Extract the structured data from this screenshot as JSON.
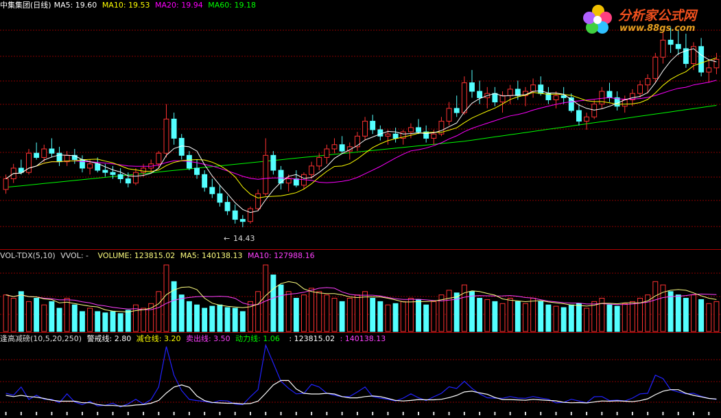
{
  "main_header": {
    "title": "中集集团(日线)",
    "ma5": "MA5: 19.60",
    "ma10": "MA10: 19.53",
    "ma20": "MA20: 19.94",
    "ma60": "MA60: 19.18"
  },
  "vol_header": {
    "name": "VOL-TDX(5,10)",
    "vvol": "VVOL: -",
    "volume": "VOLUME: 123815.02",
    "ma5": "MA5: 140138.13",
    "ma10": "MA10: 127988.16"
  },
  "ind_header": {
    "name": "逢高减磅(10,5,20,250)",
    "warn": "警戒线: 2.80",
    "reduce": "减仓线: 3.20",
    "sell": "卖出线: 3.50",
    "power": "动力线: 1.06",
    "v1": ": 123815.02",
    "v2": ": 140138.13"
  },
  "low_marker": "14.43",
  "logo": {
    "cn": "分析家公式网",
    "url": "www.88gs.com"
  },
  "colors": {
    "up": "#ff3232",
    "down": "#54ffff",
    "ma5": "#ffffff",
    "ma10": "#ffff00",
    "ma20": "#ff00ff",
    "ma60": "#00ff00",
    "grid": "#8b0000",
    "ind_blue": "#2222ff",
    "ind_white": "#ffffff"
  },
  "chart_data": {
    "type": "candlestick",
    "price_ylim": [
      13.5,
      24.5
    ],
    "candles": [
      [
        16.2,
        16.9,
        16.0,
        16.7
      ],
      [
        16.7,
        17.4,
        16.5,
        17.2
      ],
      [
        17.2,
        17.6,
        16.9,
        17.0
      ],
      [
        17.0,
        18.1,
        16.9,
        17.9
      ],
      [
        17.9,
        18.4,
        17.6,
        17.7
      ],
      [
        17.7,
        18.3,
        17.5,
        18.1
      ],
      [
        18.1,
        18.6,
        17.7,
        17.9
      ],
      [
        17.9,
        18.2,
        17.3,
        17.5
      ],
      [
        17.5,
        18.0,
        17.3,
        17.8
      ],
      [
        17.8,
        18.1,
        17.4,
        17.6
      ],
      [
        17.6,
        17.8,
        17.0,
        17.2
      ],
      [
        17.2,
        17.6,
        16.9,
        17.4
      ],
      [
        17.4,
        17.7,
        17.0,
        17.1
      ],
      [
        17.1,
        17.4,
        16.8,
        17.0
      ],
      [
        17.0,
        17.3,
        16.7,
        16.9
      ],
      [
        16.9,
        17.2,
        16.5,
        16.7
      ],
      [
        16.7,
        17.0,
        16.3,
        16.5
      ],
      [
        16.5,
        17.2,
        16.4,
        17.0
      ],
      [
        17.0,
        17.4,
        16.8,
        17.2
      ],
      [
        17.2,
        17.6,
        17.0,
        17.4
      ],
      [
        17.4,
        18.0,
        17.2,
        17.9
      ],
      [
        17.9,
        20.2,
        17.7,
        19.5
      ],
      [
        19.5,
        19.8,
        18.3,
        18.6
      ],
      [
        18.6,
        18.8,
        17.6,
        17.8
      ],
      [
        17.8,
        18.0,
        17.1,
        17.2
      ],
      [
        17.2,
        17.6,
        16.7,
        16.9
      ],
      [
        16.9,
        17.1,
        16.1,
        16.3
      ],
      [
        16.3,
        16.7,
        15.8,
        16.0
      ],
      [
        16.0,
        16.4,
        15.4,
        15.6
      ],
      [
        15.6,
        15.9,
        15.0,
        15.2
      ],
      [
        15.2,
        15.5,
        14.6,
        14.8
      ],
      [
        14.8,
        15.0,
        14.43,
        14.7
      ],
      [
        14.7,
        15.4,
        14.6,
        15.3
      ],
      [
        15.3,
        16.2,
        15.2,
        16.0
      ],
      [
        16.0,
        18.6,
        15.9,
        17.8
      ],
      [
        17.8,
        18.0,
        16.9,
        17.1
      ],
      [
        17.1,
        17.3,
        16.2,
        16.5
      ],
      [
        16.5,
        16.9,
        16.1,
        16.7
      ],
      [
        16.7,
        17.1,
        16.3,
        16.4
      ],
      [
        16.4,
        17.0,
        16.2,
        16.9
      ],
      [
        16.9,
        17.5,
        16.7,
        17.3
      ],
      [
        17.3,
        17.9,
        17.1,
        17.7
      ],
      [
        17.7,
        18.3,
        17.4,
        18.1
      ],
      [
        18.1,
        18.6,
        17.9,
        18.3
      ],
      [
        18.3,
        18.7,
        17.9,
        18.0
      ],
      [
        18.0,
        18.4,
        17.6,
        18.2
      ],
      [
        18.2,
        18.9,
        18.0,
        18.7
      ],
      [
        18.7,
        19.6,
        18.5,
        19.4
      ],
      [
        19.4,
        19.7,
        18.8,
        19.0
      ],
      [
        19.0,
        19.2,
        18.5,
        18.7
      ],
      [
        18.7,
        19.0,
        18.3,
        18.8
      ],
      [
        18.8,
        19.1,
        18.4,
        18.6
      ],
      [
        18.6,
        19.0,
        18.3,
        18.9
      ],
      [
        18.9,
        19.3,
        18.6,
        19.1
      ],
      [
        19.1,
        19.5,
        18.8,
        18.9
      ],
      [
        18.9,
        19.2,
        18.4,
        18.6
      ],
      [
        18.6,
        19.0,
        18.3,
        18.8
      ],
      [
        18.8,
        19.6,
        18.7,
        19.4
      ],
      [
        19.4,
        20.3,
        19.2,
        20.0
      ],
      [
        20.0,
        20.6,
        19.6,
        19.8
      ],
      [
        19.8,
        21.5,
        19.7,
        21.2
      ],
      [
        21.2,
        21.8,
        20.5,
        20.8
      ],
      [
        20.8,
        21.3,
        20.2,
        20.5
      ],
      [
        20.5,
        21.0,
        20.0,
        20.7
      ],
      [
        20.7,
        21.0,
        20.1,
        20.3
      ],
      [
        20.3,
        20.8,
        19.8,
        20.6
      ],
      [
        20.6,
        21.1,
        20.2,
        20.9
      ],
      [
        20.9,
        21.3,
        20.4,
        20.6
      ],
      [
        20.6,
        21.0,
        20.1,
        20.8
      ],
      [
        20.8,
        21.4,
        20.5,
        21.1
      ],
      [
        21.1,
        21.5,
        20.6,
        20.7
      ],
      [
        20.7,
        21.0,
        20.2,
        20.4
      ],
      [
        20.4,
        20.8,
        20.0,
        20.6
      ],
      [
        20.6,
        21.0,
        20.2,
        20.5
      ],
      [
        20.5,
        20.7,
        19.8,
        19.9
      ],
      [
        19.9,
        20.2,
        19.2,
        19.4
      ],
      [
        19.4,
        19.8,
        19.0,
        19.6
      ],
      [
        19.6,
        20.4,
        19.5,
        20.2
      ],
      [
        20.2,
        21.0,
        20.0,
        20.8
      ],
      [
        20.8,
        21.2,
        20.3,
        20.5
      ],
      [
        20.5,
        20.8,
        19.9,
        20.1
      ],
      [
        20.1,
        20.6,
        19.8,
        20.4
      ],
      [
        20.4,
        20.9,
        20.1,
        20.7
      ],
      [
        20.7,
        21.3,
        20.5,
        21.1
      ],
      [
        21.1,
        21.6,
        20.7,
        21.4
      ],
      [
        21.4,
        22.6,
        21.2,
        22.4
      ],
      [
        22.4,
        23.6,
        22.1,
        23.2
      ],
      [
        23.2,
        23.8,
        22.6,
        23.0
      ],
      [
        23.0,
        23.7,
        22.5,
        22.8
      ],
      [
        22.8,
        23.5,
        21.9,
        22.1
      ],
      [
        22.1,
        23.1,
        21.8,
        22.9
      ],
      [
        22.9,
        23.3,
        21.5,
        21.7
      ],
      [
        21.7,
        22.3,
        21.2,
        21.9
      ],
      [
        21.9,
        22.6,
        21.6,
        22.3
      ]
    ],
    "volumes": [
      0.55,
      0.5,
      0.6,
      0.45,
      0.5,
      0.4,
      0.45,
      0.35,
      0.5,
      0.4,
      0.3,
      0.35,
      0.3,
      0.28,
      0.3,
      0.27,
      0.32,
      0.4,
      0.35,
      0.42,
      0.6,
      1.0,
      0.75,
      0.55,
      0.45,
      0.4,
      0.35,
      0.38,
      0.4,
      0.36,
      0.35,
      0.3,
      0.45,
      0.6,
      1.0,
      0.85,
      0.7,
      0.6,
      0.5,
      0.55,
      0.65,
      0.6,
      0.55,
      0.5,
      0.45,
      0.5,
      0.55,
      0.6,
      0.5,
      0.45,
      0.4,
      0.42,
      0.45,
      0.5,
      0.48,
      0.4,
      0.45,
      0.55,
      0.62,
      0.58,
      0.7,
      0.6,
      0.5,
      0.48,
      0.45,
      0.42,
      0.5,
      0.45,
      0.42,
      0.5,
      0.45,
      0.4,
      0.38,
      0.36,
      0.4,
      0.42,
      0.35,
      0.45,
      0.5,
      0.4,
      0.38,
      0.42,
      0.45,
      0.5,
      0.55,
      0.75,
      0.7,
      0.6,
      0.55,
      0.5,
      0.55,
      0.48,
      0.42,
      0.45
    ]
  }
}
